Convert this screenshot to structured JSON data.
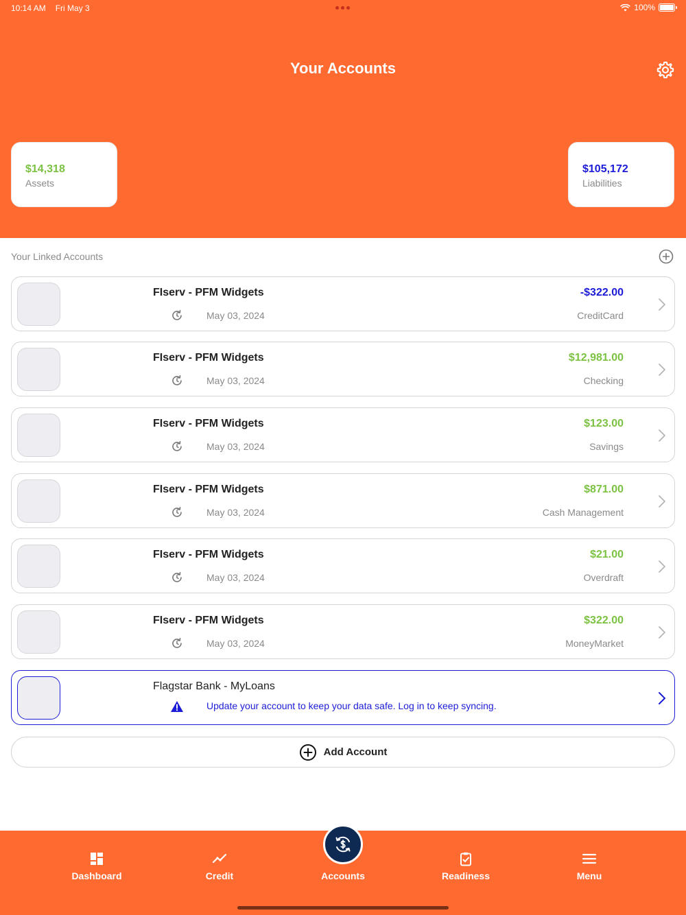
{
  "status_bar": {
    "time": "10:14 AM",
    "date": "Fri May 3",
    "battery": "100%"
  },
  "header": {
    "title": "Your Accounts"
  },
  "summary": {
    "assets": {
      "amount": "$14,318",
      "label": "Assets",
      "color": "#7cc242"
    },
    "liabilities": {
      "amount": "$105,172",
      "label": "Liabilities",
      "color": "#1c1cd8"
    }
  },
  "linked": {
    "label": "Your Linked Accounts",
    "accounts": [
      {
        "name": "FIserv - PFM Widgets",
        "date": "May 03, 2024",
        "amount": "-$322.00",
        "type": "CreditCard"
      },
      {
        "name": "FIserv - PFM Widgets",
        "date": "May 03, 2024",
        "amount": "$12,981.00",
        "type": "Checking"
      },
      {
        "name": "FIserv - PFM Widgets",
        "date": "May 03, 2024",
        "amount": "$123.00",
        "type": "Savings"
      },
      {
        "name": "FIserv - PFM Widgets",
        "date": "May 03, 2024",
        "amount": "$871.00",
        "type": "Cash Management"
      },
      {
        "name": "FIserv - PFM Widgets",
        "date": "May 03, 2024",
        "amount": "$21.00",
        "type": "Overdraft"
      },
      {
        "name": "FIserv - PFM Widgets",
        "date": "May 03, 2024",
        "amount": "$322.00",
        "type": "MoneyMarket"
      }
    ],
    "alert_account": {
      "name": "Flagstar Bank - MyLoans",
      "message": "Update your account to keep your data safe. Log in to keep syncing."
    },
    "add_account_label": "Add Account"
  },
  "tabbar": {
    "dashboard": "Dashboard",
    "credit": "Credit",
    "accounts": "Accounts",
    "readiness": "Readiness",
    "menu": "Menu"
  },
  "colors": {
    "brand": "#ff6a30",
    "positive": "#7cc242",
    "negative": "#1c1cd8",
    "fab": "#0e2a52"
  }
}
